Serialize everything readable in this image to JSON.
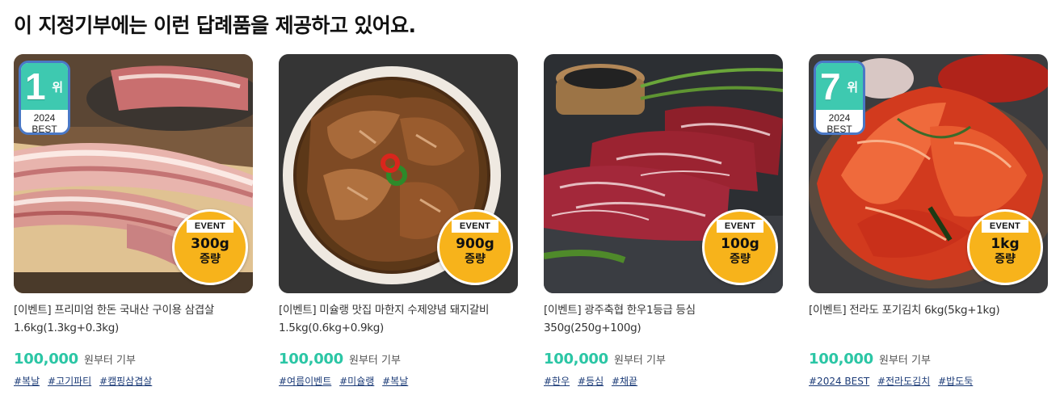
{
  "section": {
    "title": "이 지정기부에는 이런 답례품을 제공하고 있어요."
  },
  "colors": {
    "accent": "#2bc6a5",
    "rank_green": "#3ec9b0",
    "rank_border": "#4a78c6",
    "event_yellow": "#f7b31b",
    "tag_blue": "#1d3c78"
  },
  "products": [
    {
      "rank": {
        "number": "1",
        "unit": "위",
        "year": "2024",
        "label": "BEST"
      },
      "event": {
        "label": "EVENT",
        "amount": "300g",
        "word": "증량"
      },
      "name": "[이벤트] 프리미엄 한돈 국내산 구이용 삼겹살 1.6kg(1.3kg+0.3kg)",
      "price": "100,000",
      "price_suffix": "원부터 기부",
      "tags": [
        "#복날",
        "#고기파티",
        "#캠핑삼겹살"
      ]
    },
    {
      "event": {
        "label": "EVENT",
        "amount": "900g",
        "word": "증량"
      },
      "name": "[이벤트] 미슐랭 맛집 마한지 수제양념 돼지갈비 1.5kg(0.6kg+0.9kg)",
      "price": "100,000",
      "price_suffix": "원부터 기부",
      "tags": [
        "#여름이벤트",
        "#미슐랭",
        "#복날"
      ]
    },
    {
      "event": {
        "label": "EVENT",
        "amount": "100g",
        "word": "증량"
      },
      "name": "[이벤트] 광주축협 한우1등급 등심 350g(250g+100g)",
      "price": "100,000",
      "price_suffix": "원부터 기부",
      "tags": [
        "#한우",
        "#등심",
        "#채끝"
      ]
    },
    {
      "rank": {
        "number": "7",
        "unit": "위",
        "year": "2024",
        "label": "BEST"
      },
      "event": {
        "label": "EVENT",
        "amount": "1kg",
        "word": "증량"
      },
      "name": "[이벤트] 전라도 포기김치 6kg(5kg+1kg)",
      "price": "100,000",
      "price_suffix": "원부터 기부",
      "tags": [
        "#2024 BEST",
        "#전라도김치",
        "#밥도둑"
      ]
    }
  ]
}
